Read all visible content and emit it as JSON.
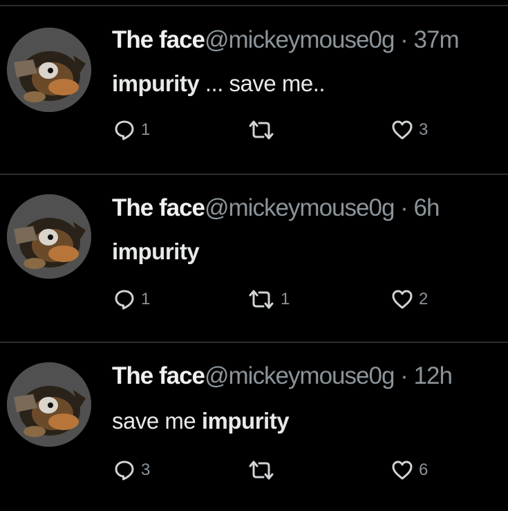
{
  "colors": {
    "background": "#000000",
    "text": "#e7e9ea",
    "muted": "#8b949a",
    "divider": "#2a2d30"
  },
  "tweets": [
    {
      "author": "The face",
      "handle": "@mickeymouse0g",
      "separator": "·",
      "time": "37m",
      "text_parts": [
        {
          "text": "impurity",
          "bold": true
        },
        {
          "text": " ... save me..",
          "bold": false
        }
      ],
      "replies": "1",
      "retweets": "",
      "likes": "3",
      "icons": {
        "reply": "reply-icon",
        "retweet": "retweet-icon",
        "like": "heart-icon"
      }
    },
    {
      "author": "The face",
      "handle": "@mickeymouse0g",
      "separator": "·",
      "time": "6h",
      "text_parts": [
        {
          "text": "impurity",
          "bold": true
        }
      ],
      "replies": "1",
      "retweets": "1",
      "likes": "2",
      "icons": {
        "reply": "reply-icon",
        "retweet": "retweet-icon",
        "like": "heart-icon"
      }
    },
    {
      "author": "The face",
      "handle": "@mickeymouse0g",
      "separator": "·",
      "time": "12h",
      "text_parts": [
        {
          "text": "save me ",
          "bold": false
        },
        {
          "text": "impurity",
          "bold": true
        }
      ],
      "replies": "3",
      "retweets": "",
      "likes": "6",
      "icons": {
        "reply": "reply-icon",
        "retweet": "retweet-icon",
        "like": "heart-icon"
      }
    }
  ]
}
